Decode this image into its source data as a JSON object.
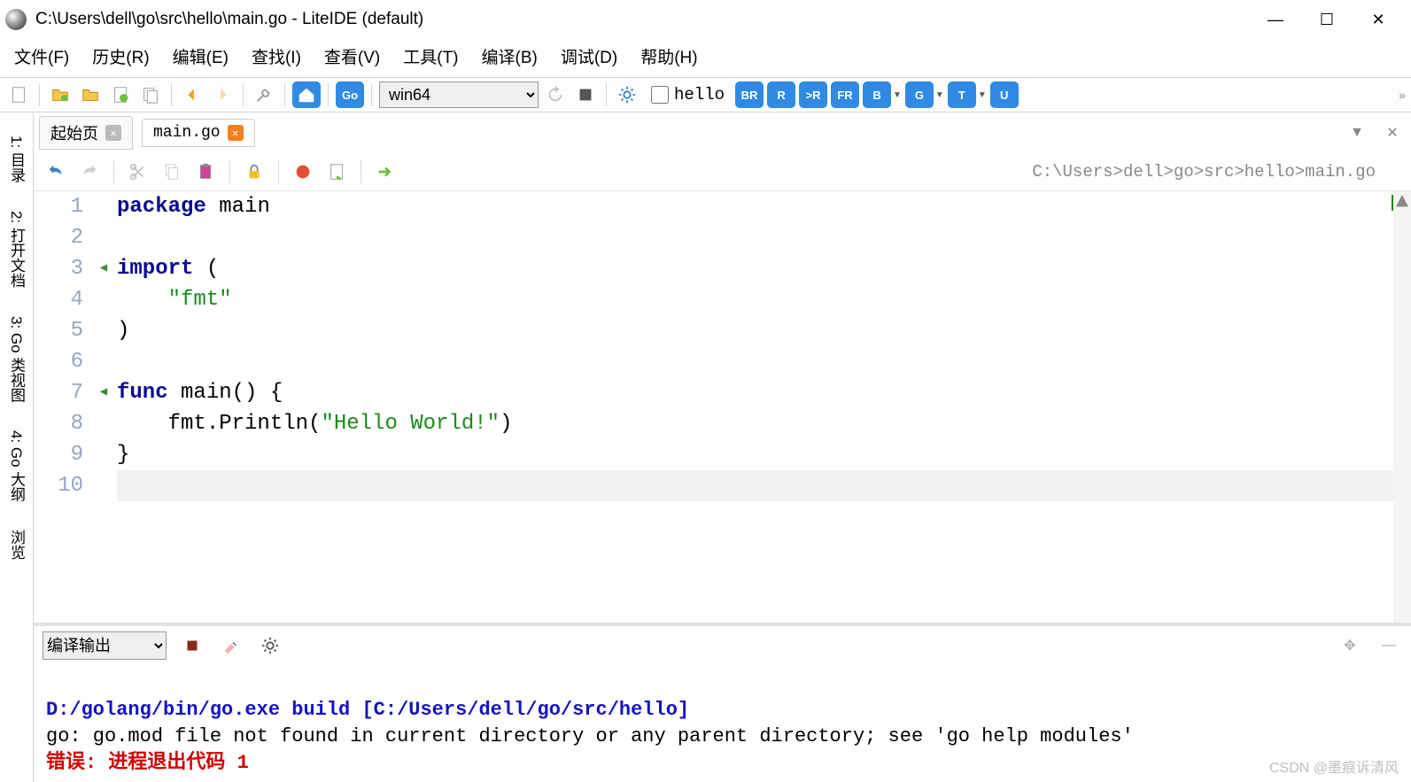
{
  "window": {
    "title": "C:\\Users\\dell\\go\\src\\hello\\main.go - LiteIDE (default)"
  },
  "menu": [
    "文件(F)",
    "历史(R)",
    "编辑(E)",
    "查找(I)",
    "查看(V)",
    "工具(T)",
    "编译(B)",
    "调试(D)",
    "帮助(H)"
  ],
  "toolbar": {
    "env_selected": "win64",
    "project_label": "hello",
    "buttons": [
      "BR",
      "R",
      ">R",
      "FR",
      "B",
      "G",
      "T",
      "U"
    ]
  },
  "side_tabs": [
    "1: 目录",
    "2: 打开文档",
    "3: Go 类视图",
    "4: Go 大纲",
    "浏览"
  ],
  "tabs": [
    {
      "label": "起始页",
      "close": "gray"
    },
    {
      "label": "main.go",
      "close": "orange",
      "active": true
    }
  ],
  "editor": {
    "breadcrumb": "C:\\Users>dell>go>src>hello>main.go",
    "lines": [
      "1",
      "2",
      "3",
      "4",
      "5",
      "6",
      "7",
      "8",
      "9",
      "10"
    ],
    "code": {
      "l1_kw": "package",
      "l1_rest": " main",
      "l3_kw": "import",
      "l3_rest": " (",
      "l4": "    \"fmt\"",
      "l5": ")",
      "l7_kw": "func",
      "l7_rest": " main() {",
      "l8_a": "    fmt.Println(",
      "l8_str": "\"Hello World!\"",
      "l8_b": ")",
      "l9": "}"
    }
  },
  "bottom": {
    "selector": "编译输出",
    "cmd": "D:/golang/bin/go.exe build [C:/Users/dell/go/src/hello]",
    "out1": "go: go.mod file not found in current directory or any parent directory; see 'go help modules'",
    "err": "错误: 进程退出代码 1"
  },
  "watermark": "CSDN @墨痕诉清风"
}
